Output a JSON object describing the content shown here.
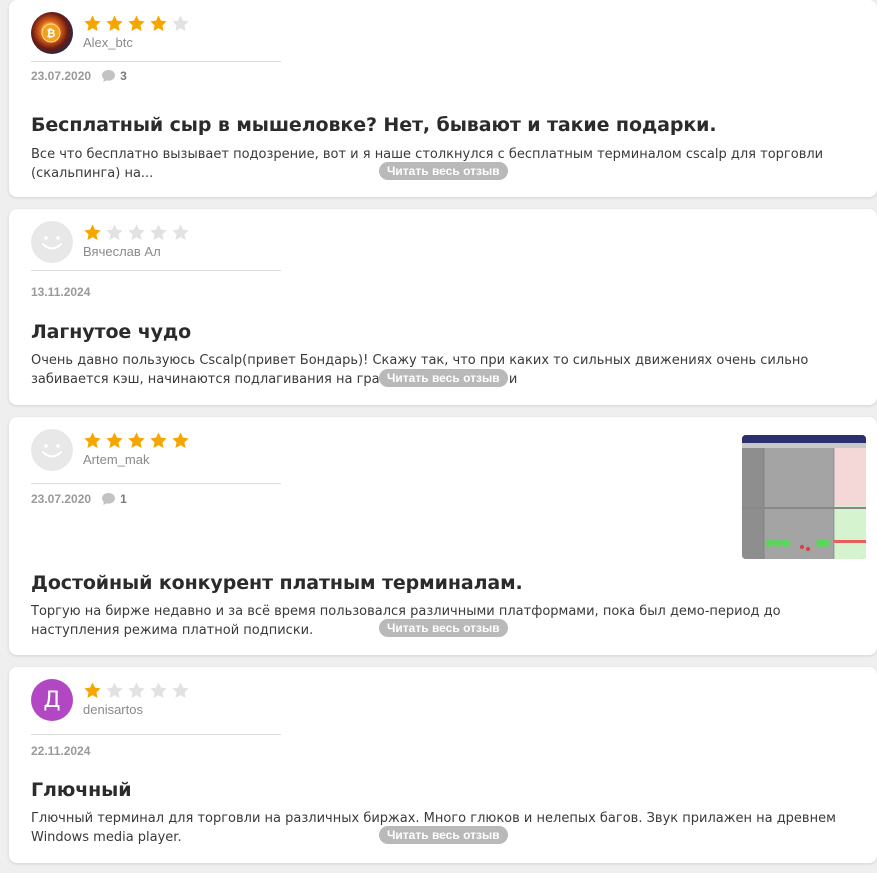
{
  "colors": {
    "star_filled": "#f7a600",
    "star_empty": "#e2e2e2",
    "read_more_bg": "#b9b9b9",
    "letter_avatar": "#b147c2"
  },
  "reviews": [
    {
      "username": "Alex_btc",
      "rating": 4,
      "date": "23.07.2020",
      "comments": "3",
      "title": "Бесплатный сыр в мышеловке? Нет, бывают и такие подарки.",
      "excerpt": "Все что бесплатно вызывает подозрение, вот и я наше столкнулся с бесплатным терминалом cscalp для торговли (скальпинга) на...",
      "read_more": "Читать весь отзыв",
      "avatar": "bitcoin-photo"
    },
    {
      "username": "Вячеслав Ал",
      "rating": 1,
      "date": "13.11.2024",
      "title": "Лагнутое чудо",
      "excerpt": "Очень давно пользуюсь Cscalp(привет Бондарь)! Скажу так, что при каких то сильных движениях очень сильно забивается кэш, начинаются подлагивания на графиках, стаканные и",
      "read_more": "Читать весь отзыв",
      "avatar": "smiley-placeholder"
    },
    {
      "username": "Artem_mak",
      "rating": 5,
      "date": "23.07.2020",
      "comments": "1",
      "title": "Достойный конкурент платным терминалам.",
      "excerpt": "Торгую на бирже недавно и за всё время пользовался различными платформами, пока был демо-период до наступления режима платной подписки.",
      "read_more": "Читать весь отзыв",
      "avatar": "smiley-placeholder",
      "has_screenshot": true
    },
    {
      "username": "denisartos",
      "rating": 1,
      "date": "22.11.2024",
      "title": "Глючный",
      "excerpt": "Глючный терминал для торговли на различных биржах. Много глюков и нелепых багов. Звук прилажен на древнем Windows media player.",
      "read_more": "Читать весь отзыв",
      "avatar": "letter",
      "avatar_letter": "Д"
    }
  ]
}
